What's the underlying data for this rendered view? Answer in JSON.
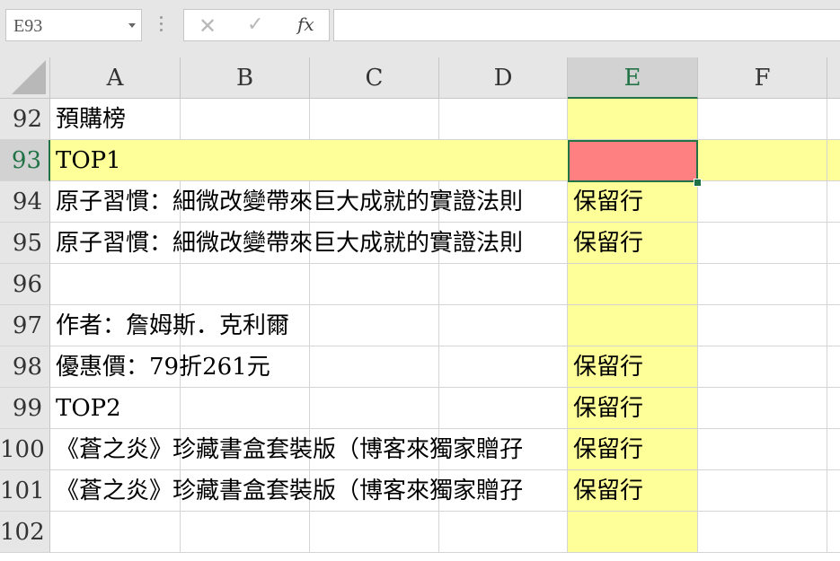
{
  "name_box": {
    "value": "E93"
  },
  "formula_bar": {
    "cancel_icon": "✕",
    "enter_icon": "✓",
    "fx_label": "fx",
    "value": ""
  },
  "columns": [
    "A",
    "B",
    "C",
    "D",
    "E",
    "F"
  ],
  "selected_column": "E",
  "rows": [
    {
      "num": "92",
      "a": "預購榜",
      "e": "",
      "highlight": false
    },
    {
      "num": "93",
      "a": "TOP1",
      "e": "",
      "highlight": true
    },
    {
      "num": "94",
      "a": "原子習慣：細微改變帶來巨大成就的實證法則",
      "e": "保留行",
      "highlight": false
    },
    {
      "num": "95",
      "a": "原子習慣：細微改變帶來巨大成就的實證法則",
      "e": "保留行",
      "highlight": false
    },
    {
      "num": "96",
      "a": "",
      "e": "",
      "highlight": false
    },
    {
      "num": "97",
      "a": "作者：詹姆斯．克利爾",
      "e": "",
      "highlight": false
    },
    {
      "num": "98",
      "a": "優惠價：79折261元",
      "e": "保留行",
      "highlight": false
    },
    {
      "num": "99",
      "a": "TOP2",
      "e": "保留行",
      "highlight": false
    },
    {
      "num": "100",
      "a": "《蒼之炎》珍藏書盒套裝版（博客來獨家贈孖",
      "e": "保留行",
      "highlight": false
    },
    {
      "num": "101",
      "a": "《蒼之炎》珍藏書盒套裝版（博客來獨家贈孖",
      "e": "保留行",
      "highlight": false
    },
    {
      "num": "102",
      "a": "",
      "e": "",
      "highlight": false
    }
  ],
  "colors": {
    "row_highlight": "#ffff99",
    "column_e_fill": "#ffff99",
    "active_cell_fill": "#ff8080",
    "selection_border": "#217346"
  }
}
